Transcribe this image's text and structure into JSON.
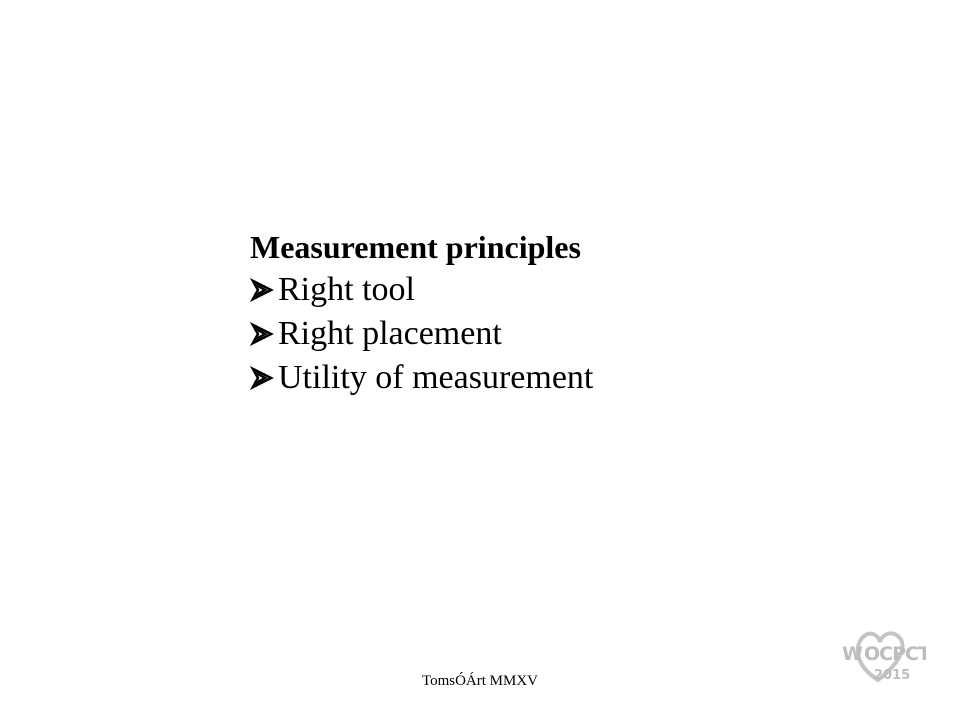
{
  "slide": {
    "heading": "Measurement principles",
    "bullets": [
      {
        "icon": "arrow-bullet-icon",
        "text": "Right tool"
      },
      {
        "icon": "arrow-bullet-icon",
        "text": "Right placement"
      },
      {
        "icon": "arrow-bullet-icon",
        "text": "Utility of measurement"
      }
    ],
    "footer": "TomsÓÁrt  MMXV"
  },
  "logo": {
    "icon": "wocpct-2015-logo",
    "lettering": "WOCPCT 2015",
    "color": "#b9b9b9"
  }
}
